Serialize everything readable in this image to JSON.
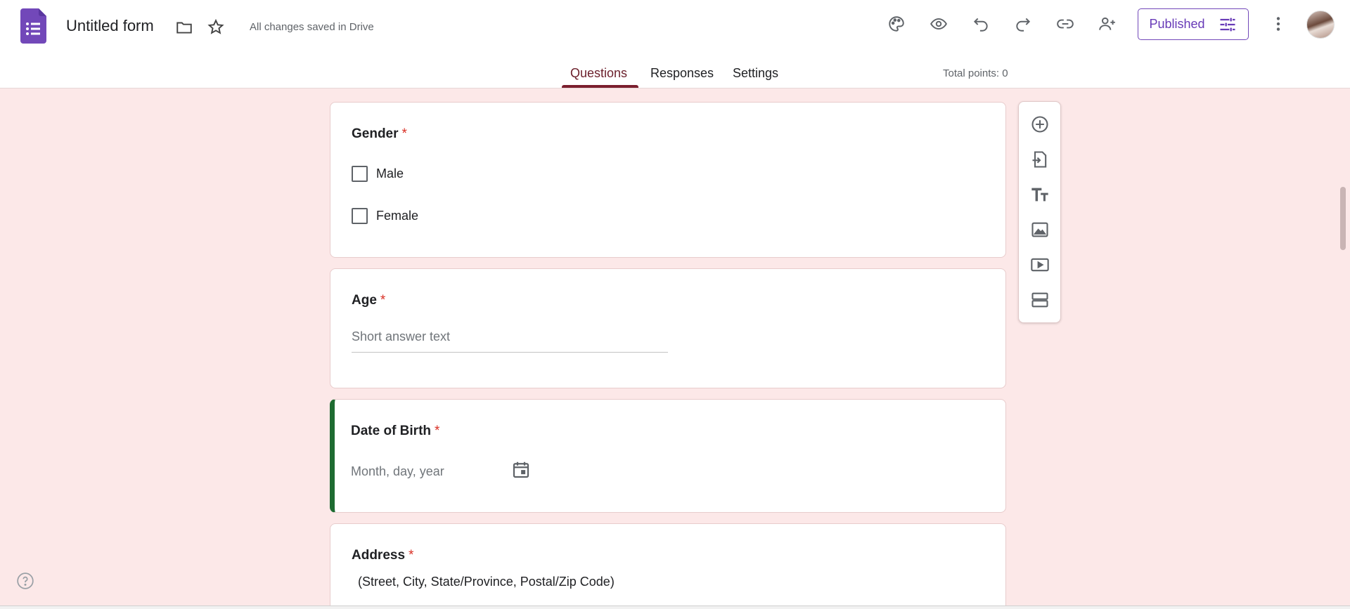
{
  "header": {
    "title": "Untitled form",
    "save_status": "All changes saved in Drive",
    "publish_label": "Published",
    "icons": [
      "forms-logo-icon",
      "folder-icon",
      "star-icon",
      "palette-icon",
      "preview-eye-icon",
      "undo-icon",
      "redo-icon",
      "link-icon",
      "add-collaborator-icon",
      "customize-icon",
      "more-vert-icon"
    ]
  },
  "tabs": [
    {
      "label": "Questions",
      "active": true
    },
    {
      "label": "Responses",
      "active": false
    },
    {
      "label": "Settings",
      "active": false
    }
  ],
  "total_points": "Total points: 0",
  "questions": [
    {
      "title": "Gender",
      "required_mark": "*",
      "type": "checkboxes",
      "options": [
        "Male",
        "Female"
      ]
    },
    {
      "title": "Age",
      "required_mark": "*",
      "type": "short-answer",
      "placeholder": "Short answer text"
    },
    {
      "title": "Date of Birth",
      "required_mark": "*",
      "type": "date",
      "placeholder": "Month, day, year"
    },
    {
      "title": "Address",
      "required_mark": "*",
      "type": "paragraph",
      "description": "(Street, City, State/Province, Postal/Zip Code)"
    }
  ],
  "side_toolbar": [
    "add-question-icon",
    "import-questions-icon",
    "add-title-icon",
    "add-image-icon",
    "add-video-icon",
    "add-section-icon"
  ],
  "colors": {
    "accent": "#673ab7",
    "background": "#fce8e8",
    "focus_bar": "#1e6b31",
    "required": "#d93025",
    "tab_active": "#7b1f2e"
  }
}
